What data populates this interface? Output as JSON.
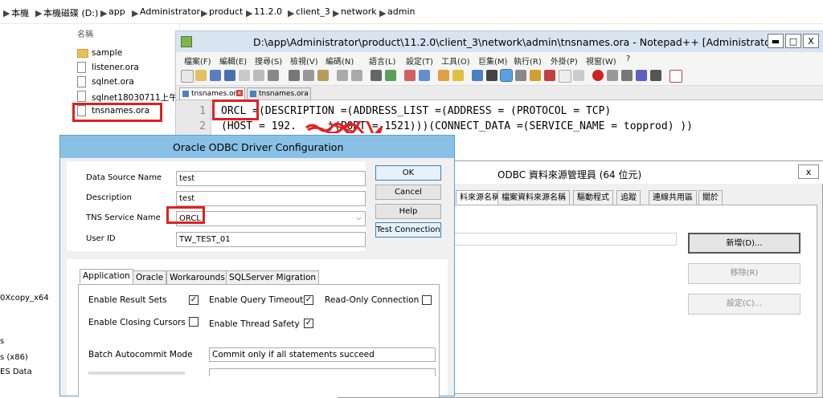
{
  "explorer": {
    "breadcrumb": [
      "本機",
      "本機磁碟 (D:)",
      "app",
      "Administrator",
      "product",
      "11.2.0",
      "client_3",
      "network",
      "admin"
    ],
    "column_name": "名稱",
    "files": [
      {
        "name": "sample",
        "type": "folder"
      },
      {
        "name": "listener.ora",
        "type": "file"
      },
      {
        "name": "sqlnet.ora",
        "type": "file"
      },
      {
        "name": "sqlnet18030711上午",
        "type": "file"
      },
      {
        "name": "tnsnames.ora",
        "type": "file"
      }
    ],
    "left_partial": [
      "0Xcopy_x64",
      "s",
      "s (x86)",
      "ES Data"
    ]
  },
  "notepad": {
    "title": "D:\\app\\Administrator\\product\\11.2.0\\client_3\\network\\admin\\tnsnames.ora - Notepad++ [Administrator]",
    "menu": [
      "檔案(F)",
      "編輯(E)",
      "搜尋(S)",
      "檢視(V)",
      "編碼(N)",
      "語言(L)",
      "設定(T)",
      "工具(O)",
      "巨集(M)",
      "執行(R)",
      "外掛(P)",
      "視窗(W)",
      "?"
    ],
    "tabs": [
      "tnsnames.ora",
      "tnsnames.ora"
    ],
    "lines": [
      {
        "no": "1",
        "text": "ORCL =(DESCRIPTION =(ADDRESS_LIST =(ADDRESS = (PROTOCOL = TCP)"
      },
      {
        "no": "2",
        "text": "(HOST = 192.     )(PORT = 1521)))(CONNECT_DATA =(SERVICE_NAME = topprod) ))"
      }
    ],
    "win_buttons": {
      "min": "▬",
      "max": "□",
      "close": "X"
    }
  },
  "odbc_admin": {
    "title": "ODBC 資料來源管理員 (64 位元)",
    "close": "x",
    "tabs": [
      "料來源名稱",
      "檔案資料來源名稱",
      "驅動程式",
      "追蹤",
      "連線共用區",
      "關於"
    ],
    "buttons": {
      "add": "新增(D)...",
      "remove": "移除(R)",
      "configure": "設定(C)..."
    }
  },
  "oracle_dialog": {
    "title": "Oracle ODBC Driver Configuration",
    "fields": {
      "dsn_label": "Data Source Name",
      "dsn_value": "test",
      "desc_label": "Description",
      "desc_value": "test",
      "tns_label": "TNS Service Name",
      "tns_value": "ORCL",
      "user_label": "User ID",
      "user_value": "TW_TEST_01"
    },
    "buttons": {
      "ok": "OK",
      "cancel": "Cancel",
      "help": "Help",
      "test": "Test Connection"
    },
    "tabs": [
      "Application",
      "Oracle",
      "Workarounds",
      "SQLServer Migration"
    ],
    "options": {
      "result_sets": "Enable Result Sets",
      "result_sets_checked": "✓",
      "query_timeout": "Enable Query Timeout",
      "query_timeout_checked": "✓",
      "readonly": "Read-Only Connection",
      "closing_cursors": "Enable Closing Cursors",
      "thread_safety": "Enable Thread Safety",
      "thread_safety_checked": "✓",
      "batch_label": "Batch Autocommit Mode",
      "batch_value": "Commit only if all statements succeed"
    }
  },
  "colors": {
    "highlight_red": "#e02020",
    "dialog_title": "#89c1e6",
    "notepad_title": "#d9e4f1"
  }
}
